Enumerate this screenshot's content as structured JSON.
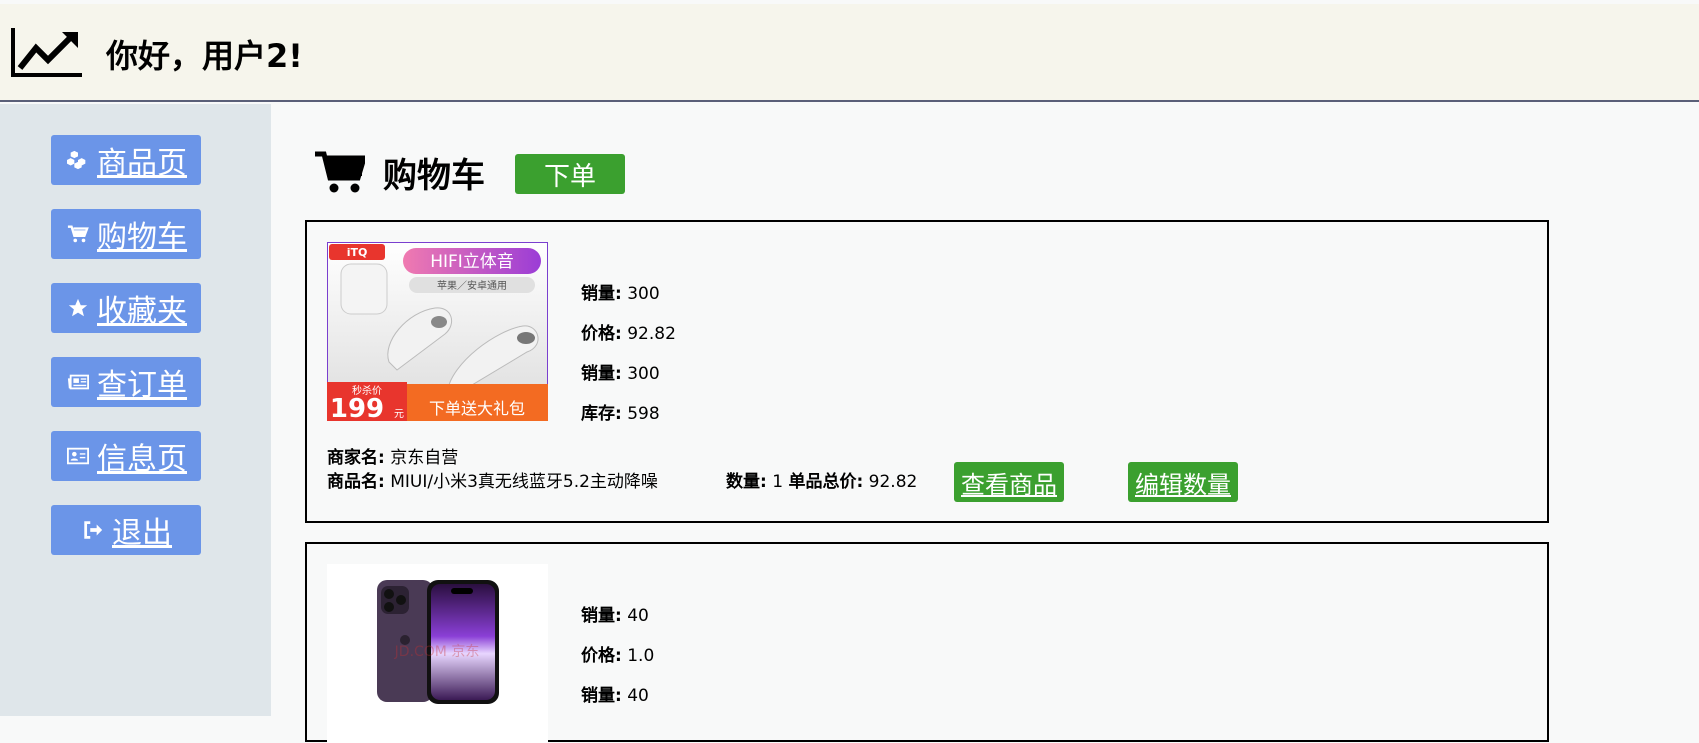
{
  "header": {
    "greeting": "你好，用户2!"
  },
  "sidebar": {
    "items": [
      {
        "label": "商品页",
        "icon": "cubes-icon"
      },
      {
        "label": "购物车",
        "icon": "cart-icon"
      },
      {
        "label": "收藏夹",
        "icon": "star-icon"
      },
      {
        "label": "查订单",
        "icon": "newspaper-icon"
      },
      {
        "label": "信息页",
        "icon": "id-card-icon"
      },
      {
        "label": "退出",
        "icon": "sign-out-icon"
      }
    ]
  },
  "main": {
    "title": "购物车",
    "order_label": "下单"
  },
  "labels": {
    "sales": "销量:",
    "price": "价格:",
    "stock": "库存:",
    "shop": "商家名:",
    "product": "商品名:",
    "quantity": "数量:",
    "subtotal": "单品总价:",
    "view": "查看商品",
    "edit": "编辑数量"
  },
  "cart_items": [
    {
      "image_text": {
        "brand": "iTQ",
        "headline": "HIFI立体音",
        "sub": "苹果／安卓通用",
        "badge": "秒杀价",
        "price": "199",
        "unit": "元",
        "promo": "下单送大礼包"
      },
      "sales": "300",
      "price": "92.82",
      "sales2": "300",
      "stock": "598",
      "shop": "京东自营",
      "product": "MIUI/小米3真无线蓝牙5.2主动降噪",
      "quantity": "1",
      "subtotal": "92.82"
    },
    {
      "image_text": {
        "watermark": "JD.COM 京东"
      },
      "sales": "40",
      "price": "1.0",
      "sales2": "40"
    }
  ],
  "colors": {
    "nav": "#6b95e8",
    "green": "#3ba02f",
    "header_bg": "#f6f5ec",
    "sidebar_bg": "#dfe6ea"
  }
}
